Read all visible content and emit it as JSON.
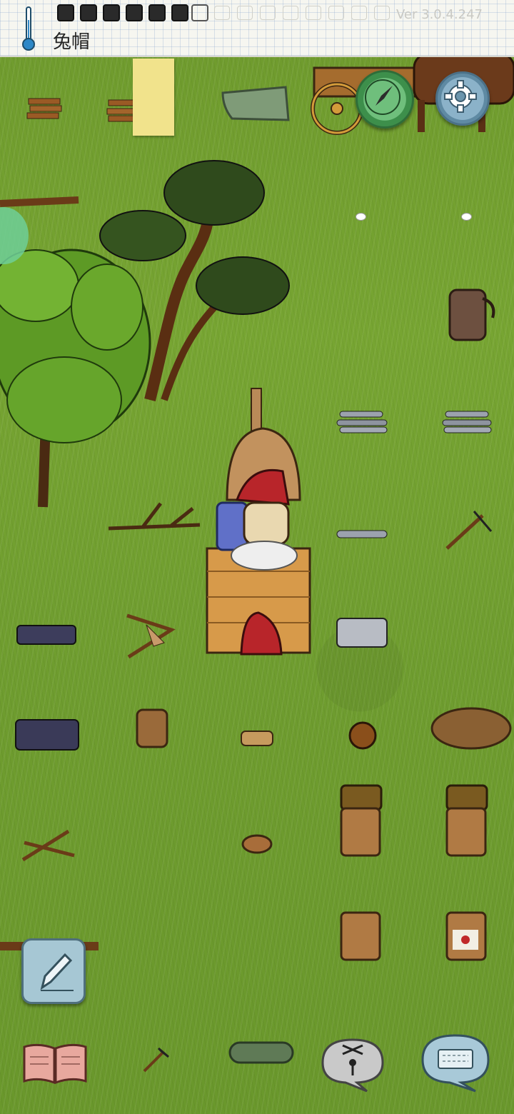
{
  "hud": {
    "held_item_label": "兔帽",
    "version": "Ver 3.0.4.247",
    "food_slots_filled": 6,
    "food_slots_total": 7,
    "icons": [
      "thermometer-icon",
      "compass-icon",
      "gear-icon",
      "pencil-icon",
      "book-icon",
      "puppet-icon",
      "keyboard-icon"
    ]
  },
  "world_objects": [
    "firewood-bundle",
    "firewood-bundle",
    "sticky-note",
    "wet-clay-roll",
    "wooden-cart",
    "horse",
    "pine-tree",
    "maple-tree",
    "branch",
    "leather-backpack",
    "flat-stones",
    "flat-stones",
    "adobe-kiln",
    "player-character",
    "stone-hatchet",
    "flat-stones",
    "flat-stone-stack",
    "bow-drill",
    "iron-ore-pile",
    "wooden-bowls",
    "clay-plate",
    "burdock",
    "kindling-pile",
    "basket-on-crock",
    "basket-on-crock",
    "crossed-sticks",
    "clay-bowl",
    "clay-crock",
    "labeled-crock",
    "stone-axe",
    "clay-roll",
    "branch"
  ],
  "colors": {
    "grass": "#72a030",
    "compass": "#4fa05c",
    "settings": "#6b95ad"
  }
}
